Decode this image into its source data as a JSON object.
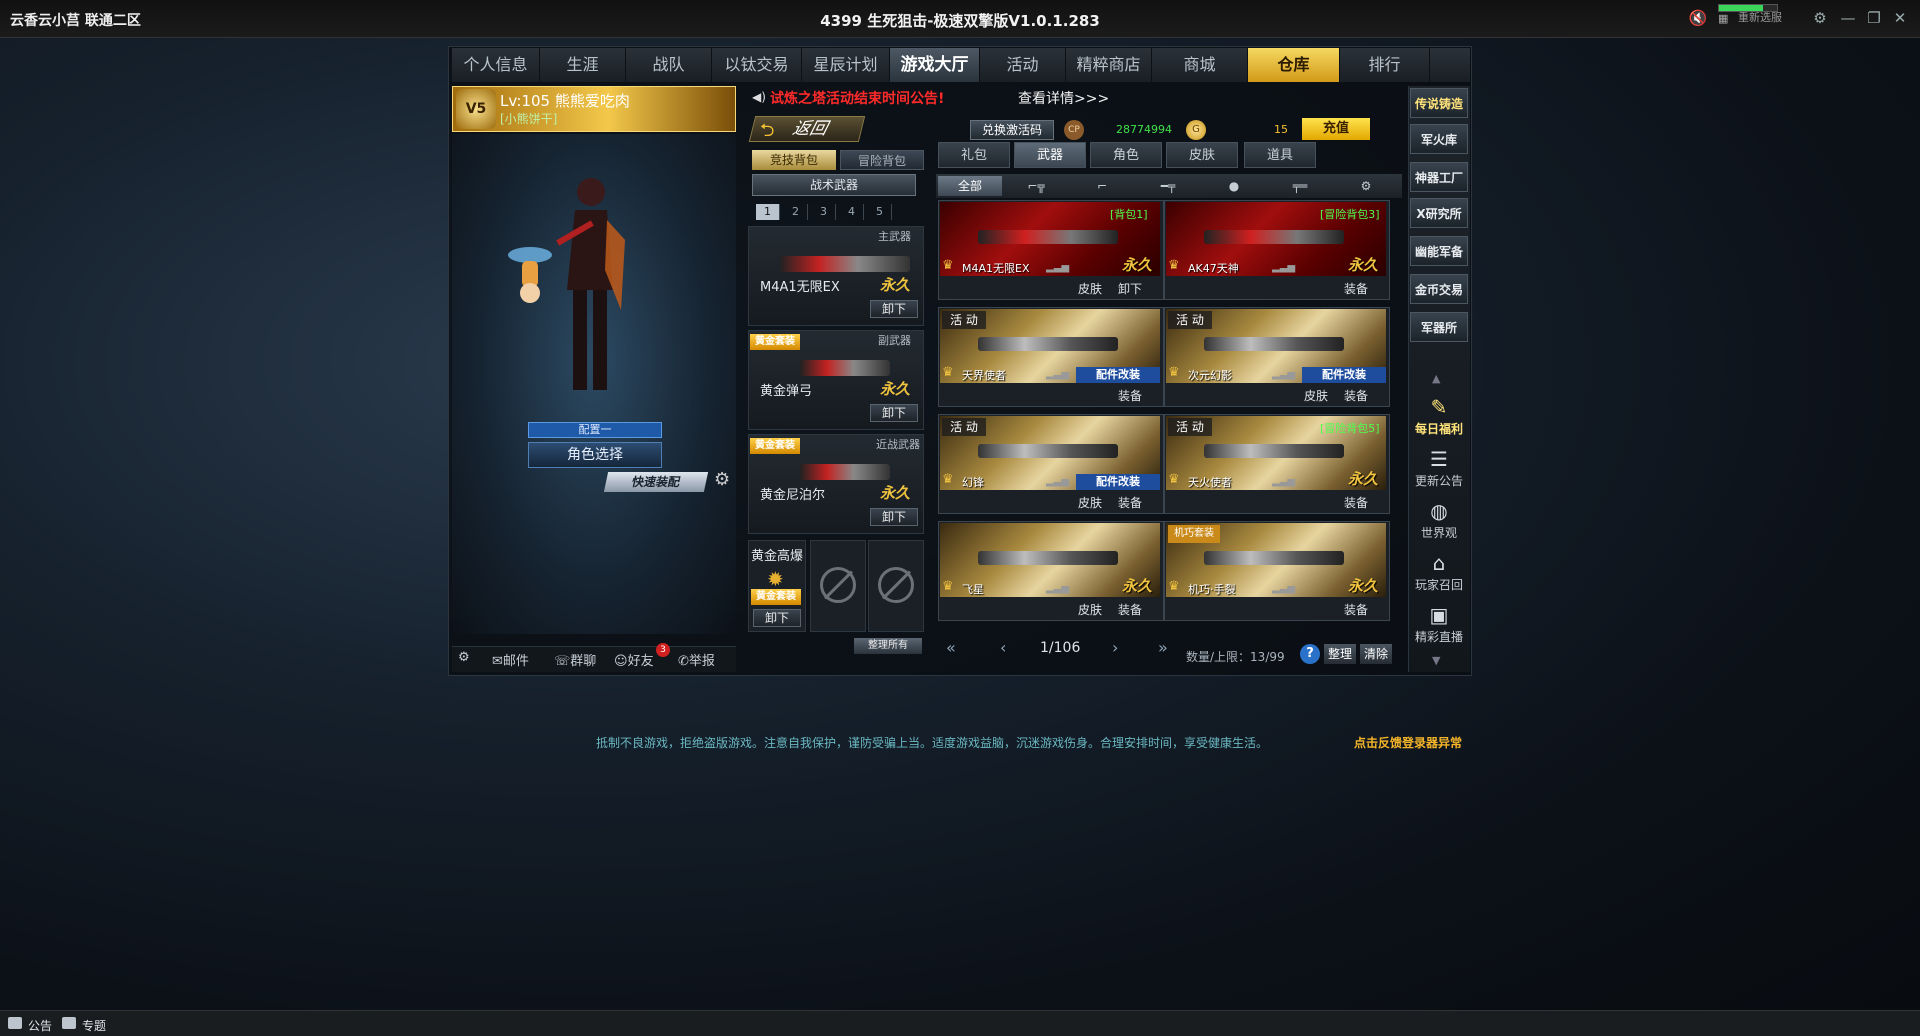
{
  "window": {
    "left_title": "云香云小莒 联通二区",
    "title": "4399 生死狙击-极速双擎版V1.0.1.283",
    "network_label": "重新选服",
    "network_level": 0.75
  },
  "nav_tabs": [
    "个人信息",
    "生涯",
    "战队",
    "以钛交易",
    "星辰计划",
    "游戏大厅",
    "活动",
    "精粹商店",
    "商城",
    "仓库",
    "排行"
  ],
  "nav_active": "仓库",
  "player": {
    "badge": "V5",
    "level_name": "Lv:105 熊熊爱吃肉",
    "sub": "[小熊饼干]",
    "config": "配置一",
    "role_select": "角色选择",
    "quick_equip": "快速装配"
  },
  "social": {
    "mail": "邮件",
    "group": "群聊",
    "friends": "好友",
    "friends_badge": "3",
    "report": "举报"
  },
  "notice": {
    "text": "试炼之塔活动结束时间公告!",
    "link": "查看详情>>>"
  },
  "toolbar": {
    "back": "返回",
    "redeem": "兑换激活码",
    "cp_icon": "CP",
    "cp_value": "28774994",
    "gold_value": "15",
    "charge": "充值"
  },
  "backpack": {
    "tab_comp": "竞技背包",
    "tab_adv": "冒险背包",
    "tactic": "战术武器",
    "pages": [
      "1",
      "2",
      "3",
      "4",
      "5"
    ],
    "slots": [
      {
        "type": "主武器",
        "name": "M4A1无限EX",
        "perm": "永久",
        "btn": "卸下",
        "tag": ""
      },
      {
        "type": "副武器",
        "name": "黄金弹弓",
        "perm": "永久",
        "btn": "卸下",
        "tag": "黄金套装"
      },
      {
        "type": "近战武器",
        "name": "黄金尼泊尔",
        "perm": "永久",
        "btn": "卸下",
        "tag": "黄金套装"
      }
    ],
    "grenade": {
      "title": "黄金高爆",
      "tag": "黄金套装",
      "btn": "卸下"
    },
    "manage": "整理所有"
  },
  "categories": [
    "礼包",
    "武器",
    "角色",
    "皮肤",
    "道具"
  ],
  "category_active": "武器",
  "filters": [
    "全部",
    "步枪",
    "手枪",
    "狙击",
    "投掷",
    "重武器",
    "其他"
  ],
  "filter_active": "全部",
  "cards": [
    {
      "name": "M4A1无限EX",
      "perm": "永久",
      "tag": "[背包1]",
      "act": "",
      "mod": "",
      "btns": [
        "皮肤",
        "卸下"
      ],
      "style": "red"
    },
    {
      "name": "AK47天神",
      "perm": "永久",
      "tag": "[冒险背包3]",
      "act": "",
      "mod": "",
      "btns": [
        "装备"
      ],
      "style": "red"
    },
    {
      "name": "天界使者",
      "perm": "",
      "tag": "",
      "act": "活 动",
      "mod": "配件改装",
      "btns": [
        "装备"
      ],
      "style": "gold"
    },
    {
      "name": "次元幻影",
      "perm": "",
      "tag": "",
      "act": "活 动",
      "mod": "配件改装",
      "btns": [
        "皮肤",
        "装备"
      ],
      "style": "gold"
    },
    {
      "name": "幻锋",
      "perm": "",
      "tag": "",
      "act": "活 动",
      "mod": "配件改装",
      "btns": [
        "皮肤",
        "装备"
      ],
      "style": "gold"
    },
    {
      "name": "天火使者",
      "perm": "永久",
      "tag": "[冒险背包5]",
      "act": "活 动",
      "mod": "",
      "btns": [
        "装备"
      ],
      "style": "gold"
    },
    {
      "name": "飞星",
      "perm": "永久",
      "tag": "",
      "act": "",
      "mod": "",
      "btns": [
        "皮肤",
        "装备"
      ],
      "style": "gold"
    },
    {
      "name": "机巧·手裂",
      "perm": "永久",
      "tag": "",
      "act": "机巧套装",
      "mod": "",
      "btns": [
        "装备"
      ],
      "style": "gold"
    }
  ],
  "pager": {
    "page": "1/106",
    "count": "数量/上限：13/99",
    "sort": "整理",
    "clear": "清除"
  },
  "side_menu": [
    "传说铸造",
    "军火库",
    "神器工厂",
    "X研究所",
    "幽能军备",
    "金币交易",
    "军器所"
  ],
  "side_icons": [
    "每日福利",
    "更新公告",
    "世界观",
    "玩家召回",
    "精彩直播"
  ],
  "footer": {
    "text": "抵制不良游戏，拒绝盗版游戏。注意自我保护，谨防受骗上当。适度游戏益脑，沉迷游戏伤身。合理安排时间，享受健康生活。",
    "link": "点击反馈登录器异常"
  },
  "bottom": {
    "notice": "公告",
    "topic": "专题"
  },
  "colors": {
    "accent_gold": "#f1c33f",
    "notice_red": "#ff2a2a",
    "money_green": "#3fe14a",
    "tab_active": "#e3b23a"
  }
}
